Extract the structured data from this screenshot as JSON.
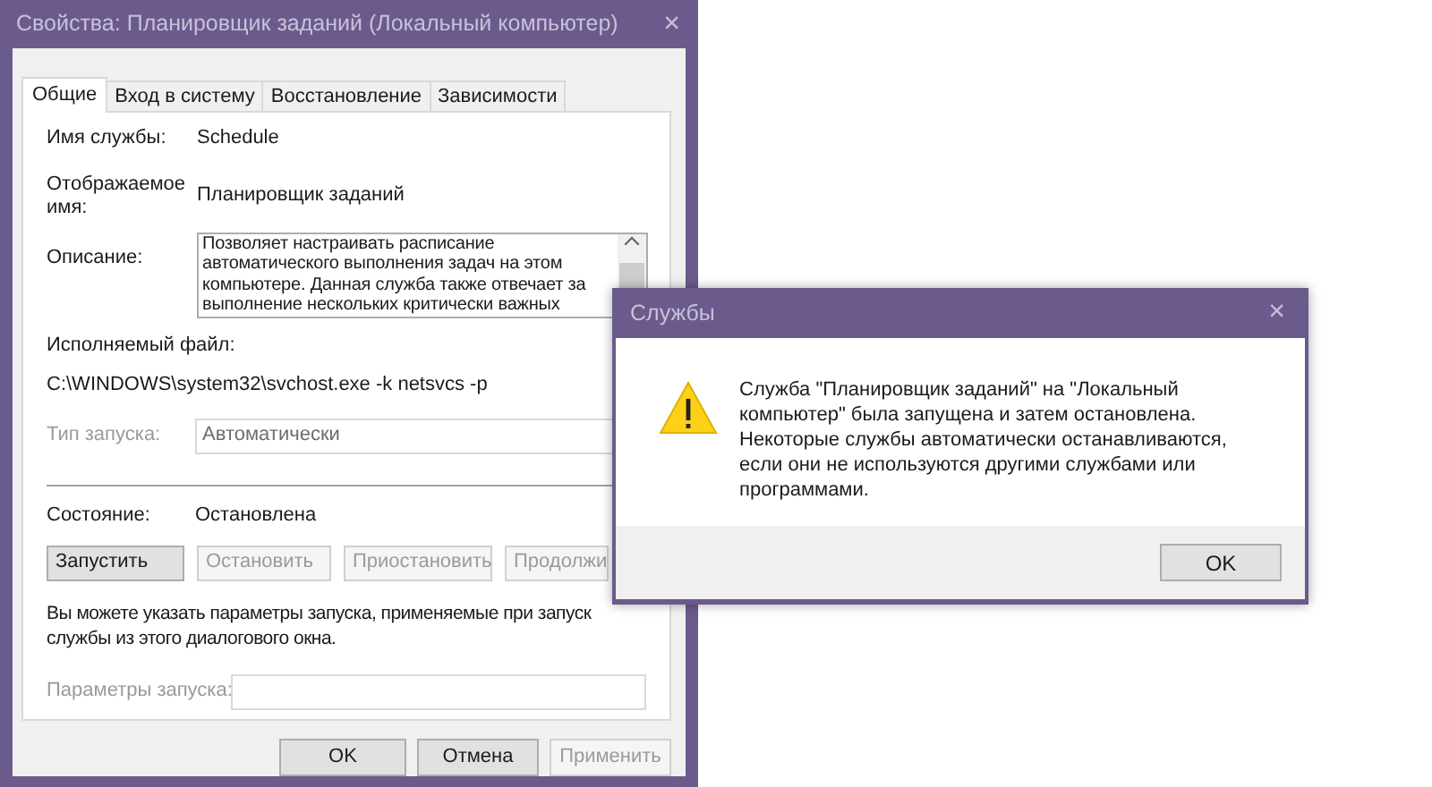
{
  "window": {
    "title": "Свойства: Планировщик заданий (Локальный компьютер)",
    "close": "×"
  },
  "tabs": [
    {
      "label": "Общие",
      "selected": true
    },
    {
      "label": "Вход в систему",
      "selected": false
    },
    {
      "label": "Восстановление",
      "selected": false
    },
    {
      "label": "Зависимости",
      "selected": false
    }
  ],
  "service_name": {
    "label": "Имя службы:",
    "value": "Schedule"
  },
  "display_name": {
    "label": "Отображаемое имя:",
    "value": "Планировщик заданий"
  },
  "description": {
    "label": "Описание:",
    "lines": [
      "Позволяет настраивать расписание",
      "автоматического выполнения задач на этом",
      "компьютере. Данная служба также отвечает за",
      "выполнение нескольких критически важных"
    ]
  },
  "executable": {
    "label": "Исполняемый файл:",
    "value": "C:\\WINDOWS\\system32\\svchost.exe -k netsvcs -p"
  },
  "startup_type": {
    "label": "Тип запуска:",
    "value": "Автоматически",
    "disabled": true
  },
  "status": {
    "label": "Состояние:",
    "value": "Остановлена"
  },
  "service_buttons": [
    {
      "label": "Запустить",
      "disabled": false
    },
    {
      "label": "Остановить",
      "disabled": true
    },
    {
      "label": "Приостановить",
      "disabled": true
    },
    {
      "label": "Продолжи",
      "disabled": true
    }
  ],
  "hint_lines": [
    "Вы можете указать параметры запуска, применяемые при запуск",
    "службы из этого диалогового окна."
  ],
  "start_params": {
    "label": "Параметры запуска:",
    "disabled": true
  },
  "dialog_buttons": [
    {
      "label": "OK",
      "disabled": false
    },
    {
      "label": "Отмена",
      "disabled": false
    },
    {
      "label": "Применить",
      "disabled": true
    }
  ],
  "message_box": {
    "title": "Службы",
    "close": "×",
    "message": "Служба \"Планировщик заданий\" на \"Локальный компьютер\" была запущена и затем остановлена. Некоторые службы автоматически останавливаются, если они не используются другими службами или программами.",
    "button": "OK"
  }
}
